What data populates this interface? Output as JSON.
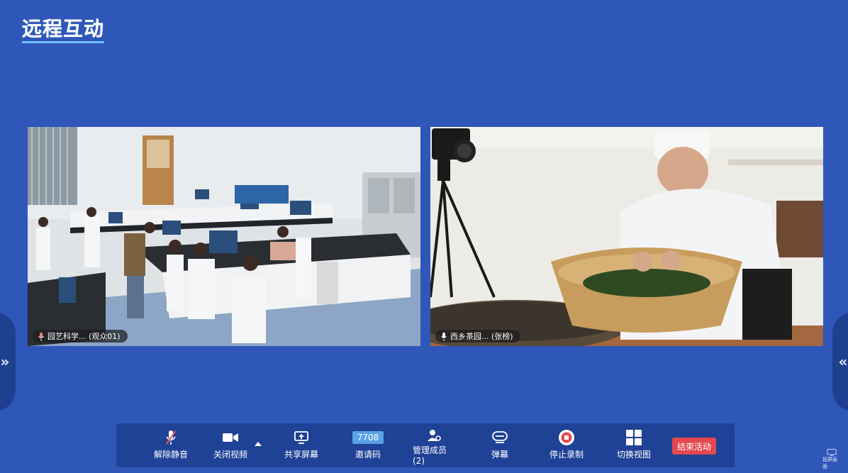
{
  "page": {
    "title": "远程互动"
  },
  "videos": [
    {
      "name": "园艺科学... (观众01)"
    },
    {
      "name": "西乡茶园... (张榜)"
    }
  ],
  "side": {
    "left_arrow": "»",
    "right_arrow": "«"
  },
  "toolbar": {
    "unmute": "解除静音",
    "close_video": "关闭视频",
    "share_screen": "共享屏幕",
    "invite_code_value": "7708",
    "invite_code": "邀请码",
    "manage_members": "管理成员(2)",
    "danmaku": "弹幕",
    "stop_record": "停止录制",
    "switch_view": "切换视图",
    "end_activity": "结束活动"
  },
  "corner": {
    "label": "投屏画面"
  },
  "colors": {
    "background": "#2f56b9",
    "toolbar": "#1f4196",
    "end_button": "#e5474e",
    "invite_badge": "#5aa1e6"
  }
}
